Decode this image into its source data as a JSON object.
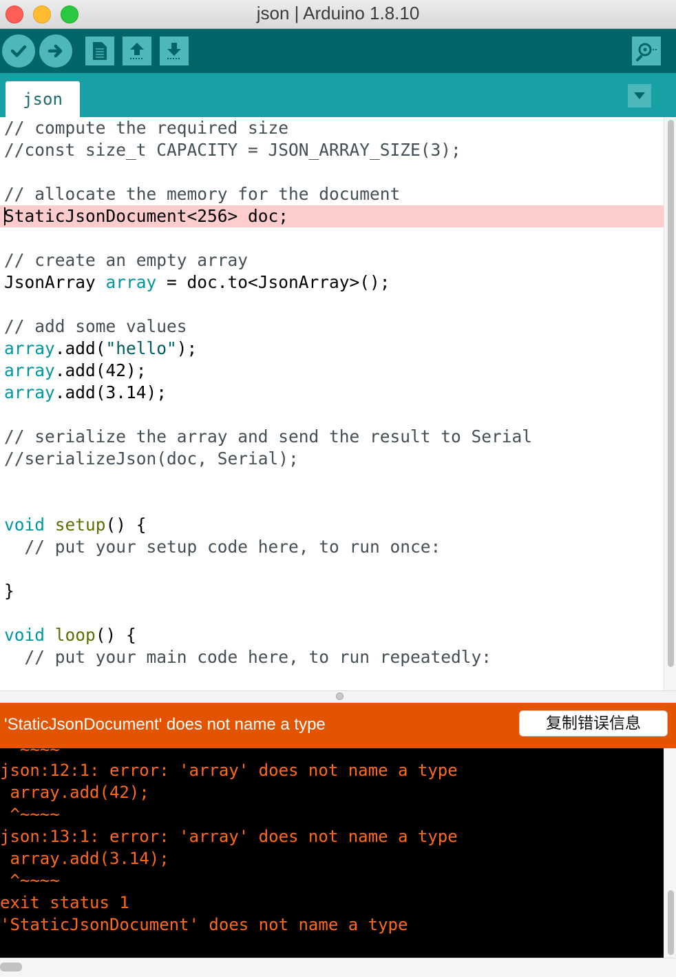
{
  "window": {
    "title": "json | Arduino 1.8.10"
  },
  "toolbar": {
    "buttons": [
      {
        "name": "verify",
        "icon": "check-icon"
      },
      {
        "name": "upload",
        "icon": "arrow-right-icon"
      },
      {
        "name": "new",
        "icon": "new-file-icon"
      },
      {
        "name": "open",
        "icon": "arrow-up-icon"
      },
      {
        "name": "save",
        "icon": "arrow-down-icon"
      },
      {
        "name": "serial-monitor",
        "icon": "magnifier-icon"
      }
    ],
    "colors": {
      "bar": "#006468",
      "button": "#4db7bb"
    }
  },
  "tabs": {
    "active": "json",
    "menu_icon": "triangle-down-icon"
  },
  "editor": {
    "highlighted_line": 4,
    "lines": [
      "// compute the required size",
      "//const size_t CAPACITY = JSON_ARRAY_SIZE(3);",
      "",
      "// allocate the memory for the document",
      "StaticJsonDocument<256> doc;",
      "",
      "// create an empty array",
      "JsonArray array = doc.to<JsonArray>();",
      "",
      "// add some values",
      "array.add(\"hello\");",
      "array.add(42);",
      "array.add(3.14);",
      "",
      "// serialize the array and send the result to Serial",
      "//serializeJson(doc, Serial);",
      "",
      "",
      "void setup() {",
      "  // put your setup code here, to run once:",
      "",
      "}",
      "",
      "void loop() {",
      "  // put your main code here, to run repeatedly:"
    ]
  },
  "status": {
    "message": "'StaticJsonDocument' does not name a type",
    "copy_button_label": "复制错误信息",
    "color": "#e35400"
  },
  "console": {
    "lines": [
      " ^~~~~",
      "json:12:1: error: 'array' does not name a type",
      " array.add(42);",
      " ^~~~~",
      "json:13:1: error: 'array' does not name a type",
      " array.add(3.14);",
      " ^~~~~",
      "exit status 1",
      "'StaticJsonDocument' does not name a type"
    ],
    "text_color": "#ff6a1a"
  }
}
